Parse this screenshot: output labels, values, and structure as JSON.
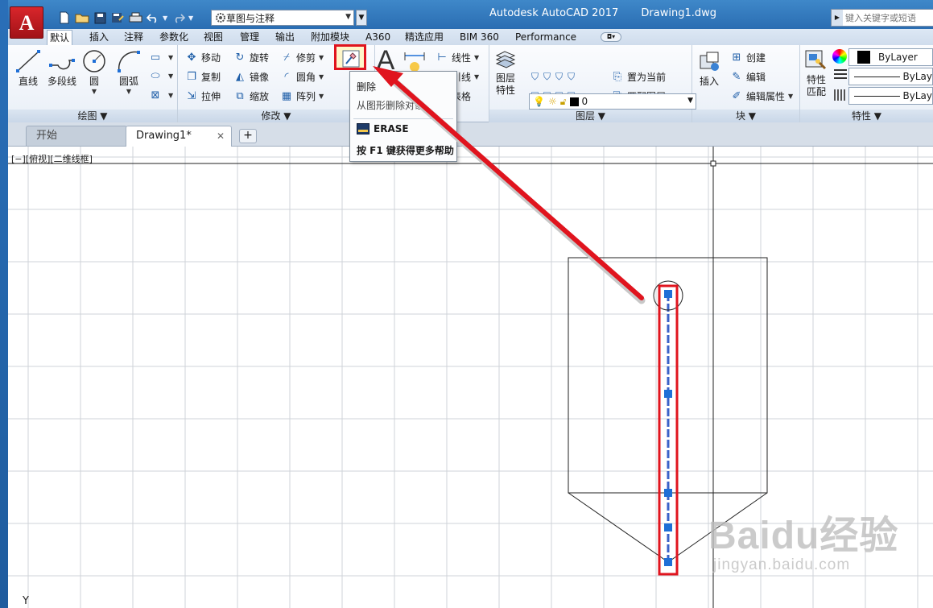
{
  "window": {
    "app_name": "Autodesk AutoCAD 2017",
    "file_name": "Drawing1.dwg",
    "logo_letter": "A"
  },
  "quick_access": {
    "workspace": "草图与注释",
    "help_search_placeholder": "键入关键字或短语"
  },
  "ribbon_tabs": [
    {
      "label": "默认",
      "active": true
    },
    {
      "label": "插入"
    },
    {
      "label": "注释"
    },
    {
      "label": "参数化"
    },
    {
      "label": "视图"
    },
    {
      "label": "管理"
    },
    {
      "label": "输出"
    },
    {
      "label": "附加模块"
    },
    {
      "label": "A360"
    },
    {
      "label": "精选应用"
    },
    {
      "label": "BIM 360"
    },
    {
      "label": "Performance"
    }
  ],
  "panels": {
    "draw": {
      "title": "绘图",
      "line": "直线",
      "polyline": "多段线",
      "circle": "圆",
      "arc": "圆弧"
    },
    "modify": {
      "title": "修改",
      "move": "移动",
      "rotate": "旋转",
      "trim": "修剪",
      "copy": "复制",
      "mirror": "镜像",
      "fillet": "圆角",
      "stretch": "拉伸",
      "scale": "缩放",
      "array": "阵列"
    },
    "annotation": {
      "linear": "线性",
      "leader": "引线",
      "table": "表格"
    },
    "layers": {
      "title": "图层",
      "layer_props_line1": "图层",
      "layer_props_line2": "特性",
      "current_layer": "0",
      "set_current": "置为当前",
      "match_layer": "匹配图层"
    },
    "block": {
      "title": "块",
      "insert": "插入",
      "create": "创建",
      "edit": "编辑",
      "edit_attributes": "编辑属性"
    },
    "properties": {
      "title": "特性",
      "match_line1": "特性",
      "match_line2": "匹配",
      "color": "ByLayer",
      "linetype": "ByLay",
      "lineweight": "ByLay"
    }
  },
  "tooltip": {
    "title": "删除",
    "description": "从图形删除对象",
    "command": "ERASE",
    "help": "按 F1 键获得更多帮助"
  },
  "file_tabs": {
    "start": "开始",
    "drawing": "Drawing1*",
    "add": "+"
  },
  "canvas": {
    "viewport_label": "[−][俯视][二维线框]",
    "axis_label": "Y"
  },
  "watermark": {
    "main": "Baidu经验",
    "sub": "jingyan.baidu.com"
  },
  "colors": {
    "accent_red": "#e0141e",
    "title_blue": "#2a6db2",
    "grip_blue": "#1f6fd6"
  }
}
